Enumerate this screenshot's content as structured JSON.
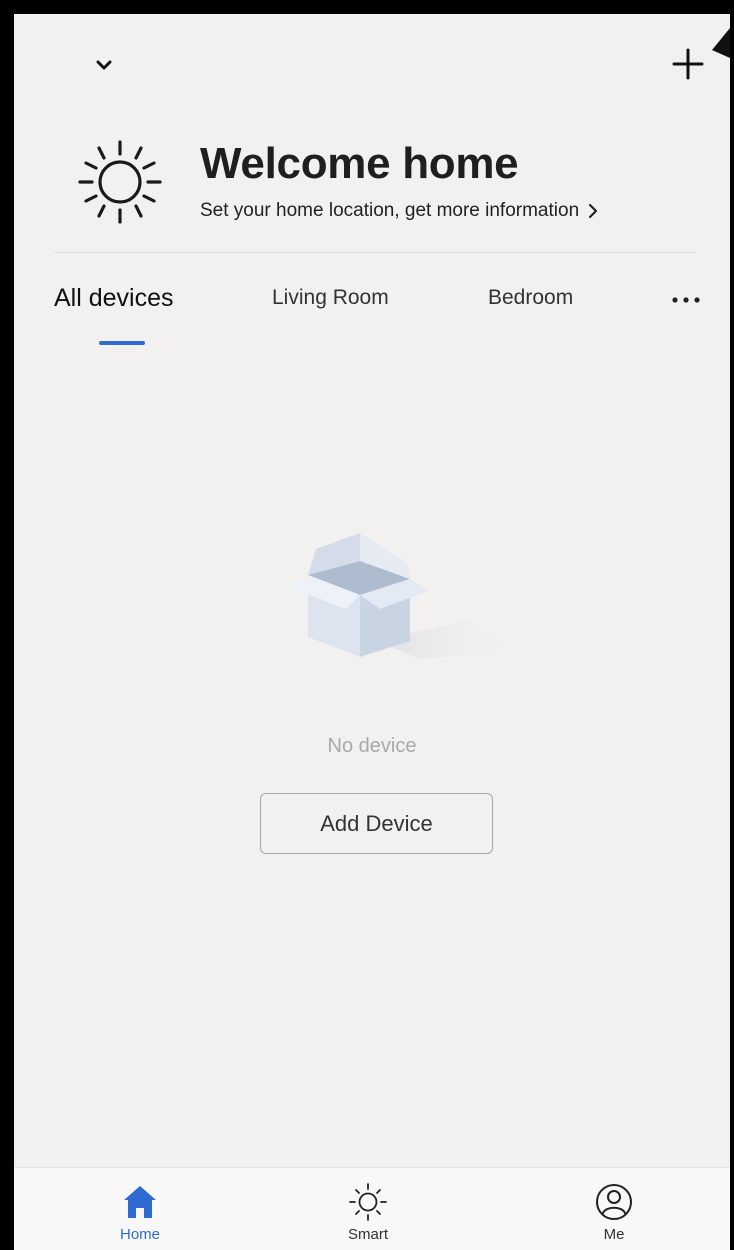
{
  "header": {
    "home_switch_icon": "chevron-down-icon",
    "add_icon": "plus-icon"
  },
  "welcome": {
    "icon": "sun-icon",
    "title": "Welcome home",
    "subtitle": "Set your home location, get more information"
  },
  "tabs": [
    {
      "label": "All devices",
      "active": true
    },
    {
      "label": "Living Room",
      "active": false
    },
    {
      "label": "Bedroom",
      "active": false
    }
  ],
  "empty_state": {
    "icon": "empty-box-icon",
    "message": "No device",
    "button_label": "Add Device"
  },
  "bottom_nav": [
    {
      "label": "Home",
      "icon": "home-icon",
      "active": true
    },
    {
      "label": "Smart",
      "icon": "sun-icon",
      "active": false
    },
    {
      "label": "Me",
      "icon": "profile-icon",
      "active": false
    }
  ],
  "colors": {
    "accent": "#2f6bd3",
    "background": "#f3f1ef",
    "muted_text": "#a9a9ad"
  }
}
